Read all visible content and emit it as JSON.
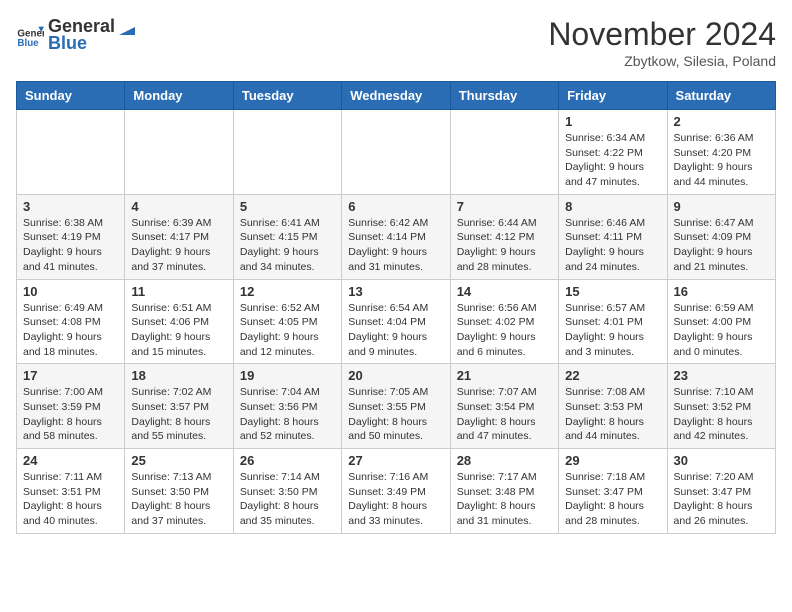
{
  "logo": {
    "text_general": "General",
    "text_blue": "Blue"
  },
  "title": "November 2024",
  "location": "Zbytkow, Silesia, Poland",
  "days_of_week": [
    "Sunday",
    "Monday",
    "Tuesday",
    "Wednesday",
    "Thursday",
    "Friday",
    "Saturday"
  ],
  "weeks": [
    [
      {
        "day": "",
        "info": ""
      },
      {
        "day": "",
        "info": ""
      },
      {
        "day": "",
        "info": ""
      },
      {
        "day": "",
        "info": ""
      },
      {
        "day": "",
        "info": ""
      },
      {
        "day": "1",
        "info": "Sunrise: 6:34 AM\nSunset: 4:22 PM\nDaylight: 9 hours and 47 minutes."
      },
      {
        "day": "2",
        "info": "Sunrise: 6:36 AM\nSunset: 4:20 PM\nDaylight: 9 hours and 44 minutes."
      }
    ],
    [
      {
        "day": "3",
        "info": "Sunrise: 6:38 AM\nSunset: 4:19 PM\nDaylight: 9 hours and 41 minutes."
      },
      {
        "day": "4",
        "info": "Sunrise: 6:39 AM\nSunset: 4:17 PM\nDaylight: 9 hours and 37 minutes."
      },
      {
        "day": "5",
        "info": "Sunrise: 6:41 AM\nSunset: 4:15 PM\nDaylight: 9 hours and 34 minutes."
      },
      {
        "day": "6",
        "info": "Sunrise: 6:42 AM\nSunset: 4:14 PM\nDaylight: 9 hours and 31 minutes."
      },
      {
        "day": "7",
        "info": "Sunrise: 6:44 AM\nSunset: 4:12 PM\nDaylight: 9 hours and 28 minutes."
      },
      {
        "day": "8",
        "info": "Sunrise: 6:46 AM\nSunset: 4:11 PM\nDaylight: 9 hours and 24 minutes."
      },
      {
        "day": "9",
        "info": "Sunrise: 6:47 AM\nSunset: 4:09 PM\nDaylight: 9 hours and 21 minutes."
      }
    ],
    [
      {
        "day": "10",
        "info": "Sunrise: 6:49 AM\nSunset: 4:08 PM\nDaylight: 9 hours and 18 minutes."
      },
      {
        "day": "11",
        "info": "Sunrise: 6:51 AM\nSunset: 4:06 PM\nDaylight: 9 hours and 15 minutes."
      },
      {
        "day": "12",
        "info": "Sunrise: 6:52 AM\nSunset: 4:05 PM\nDaylight: 9 hours and 12 minutes."
      },
      {
        "day": "13",
        "info": "Sunrise: 6:54 AM\nSunset: 4:04 PM\nDaylight: 9 hours and 9 minutes."
      },
      {
        "day": "14",
        "info": "Sunrise: 6:56 AM\nSunset: 4:02 PM\nDaylight: 9 hours and 6 minutes."
      },
      {
        "day": "15",
        "info": "Sunrise: 6:57 AM\nSunset: 4:01 PM\nDaylight: 9 hours and 3 minutes."
      },
      {
        "day": "16",
        "info": "Sunrise: 6:59 AM\nSunset: 4:00 PM\nDaylight: 9 hours and 0 minutes."
      }
    ],
    [
      {
        "day": "17",
        "info": "Sunrise: 7:00 AM\nSunset: 3:59 PM\nDaylight: 8 hours and 58 minutes."
      },
      {
        "day": "18",
        "info": "Sunrise: 7:02 AM\nSunset: 3:57 PM\nDaylight: 8 hours and 55 minutes."
      },
      {
        "day": "19",
        "info": "Sunrise: 7:04 AM\nSunset: 3:56 PM\nDaylight: 8 hours and 52 minutes."
      },
      {
        "day": "20",
        "info": "Sunrise: 7:05 AM\nSunset: 3:55 PM\nDaylight: 8 hours and 50 minutes."
      },
      {
        "day": "21",
        "info": "Sunrise: 7:07 AM\nSunset: 3:54 PM\nDaylight: 8 hours and 47 minutes."
      },
      {
        "day": "22",
        "info": "Sunrise: 7:08 AM\nSunset: 3:53 PM\nDaylight: 8 hours and 44 minutes."
      },
      {
        "day": "23",
        "info": "Sunrise: 7:10 AM\nSunset: 3:52 PM\nDaylight: 8 hours and 42 minutes."
      }
    ],
    [
      {
        "day": "24",
        "info": "Sunrise: 7:11 AM\nSunset: 3:51 PM\nDaylight: 8 hours and 40 minutes."
      },
      {
        "day": "25",
        "info": "Sunrise: 7:13 AM\nSunset: 3:50 PM\nDaylight: 8 hours and 37 minutes."
      },
      {
        "day": "26",
        "info": "Sunrise: 7:14 AM\nSunset: 3:50 PM\nDaylight: 8 hours and 35 minutes."
      },
      {
        "day": "27",
        "info": "Sunrise: 7:16 AM\nSunset: 3:49 PM\nDaylight: 8 hours and 33 minutes."
      },
      {
        "day": "28",
        "info": "Sunrise: 7:17 AM\nSunset: 3:48 PM\nDaylight: 8 hours and 31 minutes."
      },
      {
        "day": "29",
        "info": "Sunrise: 7:18 AM\nSunset: 3:47 PM\nDaylight: 8 hours and 28 minutes."
      },
      {
        "day": "30",
        "info": "Sunrise: 7:20 AM\nSunset: 3:47 PM\nDaylight: 8 hours and 26 minutes."
      }
    ]
  ]
}
